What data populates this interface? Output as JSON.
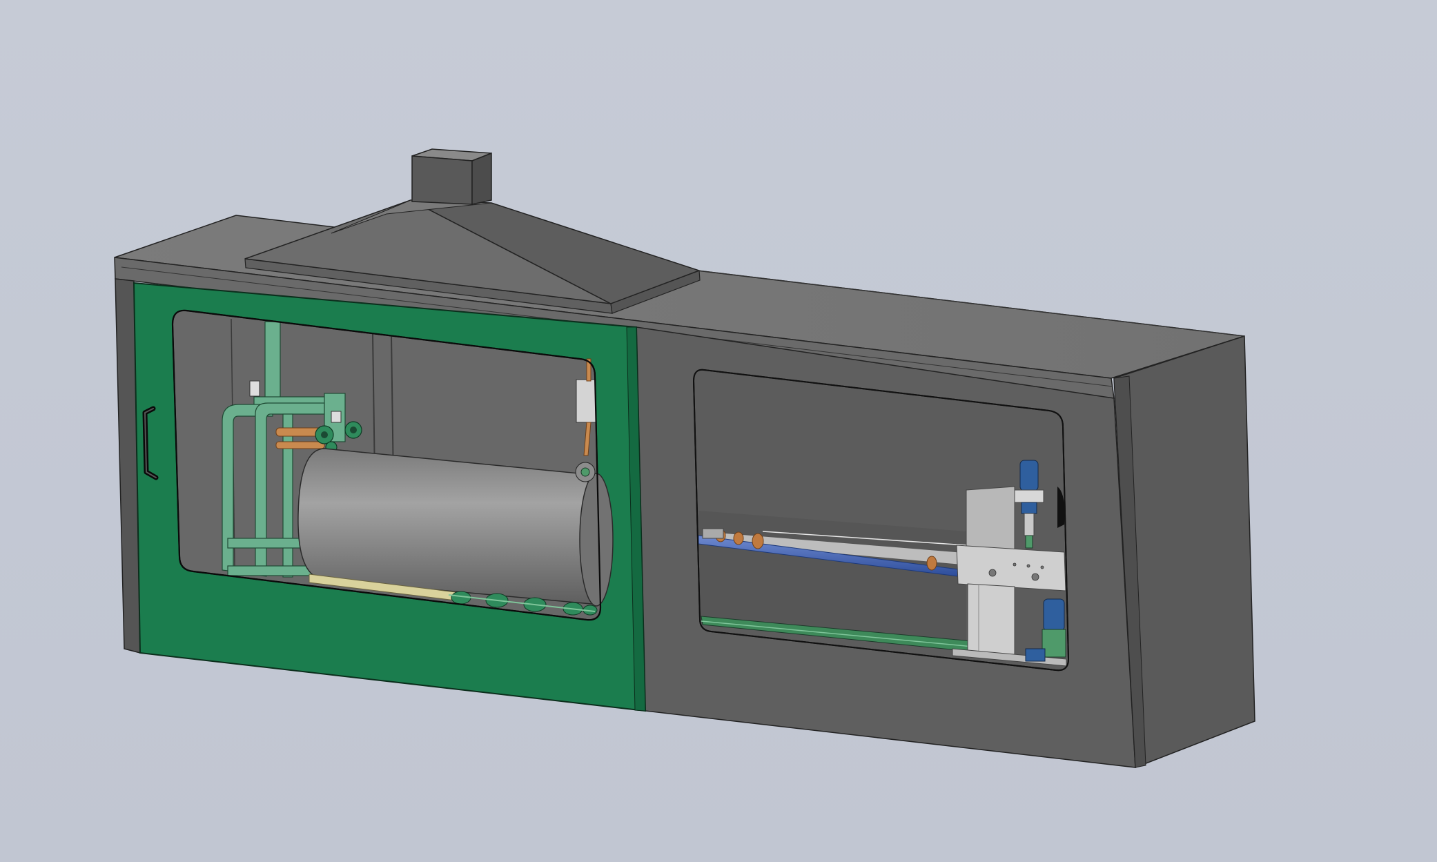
{
  "viewport": {
    "background_color": "#c3c8d4"
  },
  "model": {
    "colors": {
      "housing": "#5f5f5f",
      "housing_dark": "#4a4a4a",
      "housing_top": "#777777",
      "door": "#1b7d4e",
      "door_dark": "#146a41",
      "glass": "#6c6c6c",
      "frame_green": "#6bb08e",
      "roll": "#8e8e8e",
      "rod_blue": "#3b5fb5",
      "fitting_copper": "#c5844d",
      "aluminium": "#c9c9c9",
      "motor_blue": "#2f5f9e",
      "rail_green": "#4f9a6a",
      "cream_rod": "#d9d29c"
    },
    "icons": {
      "door_handle": "door-handle-icon"
    }
  }
}
